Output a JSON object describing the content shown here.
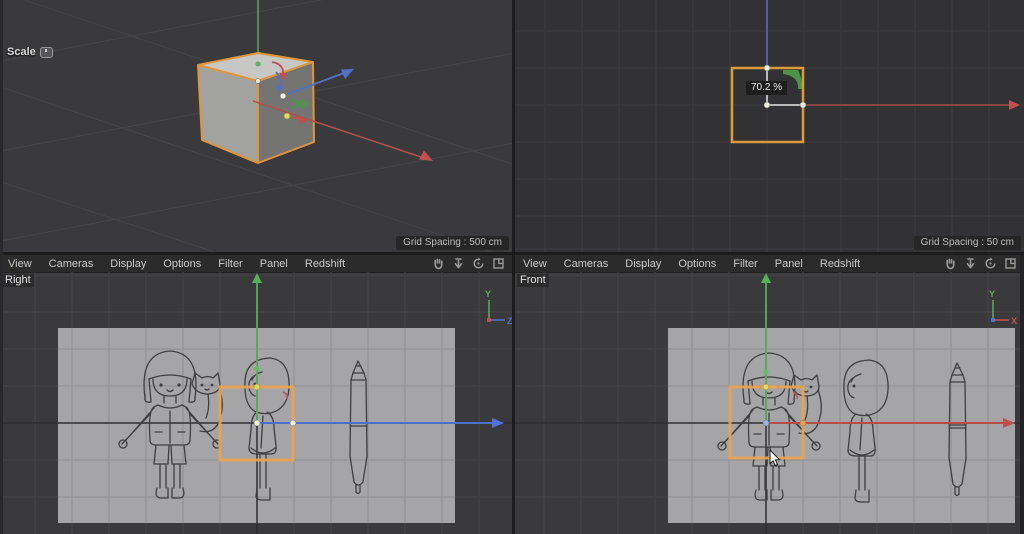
{
  "tool": {
    "label": "Scale"
  },
  "menu": {
    "items": [
      "View",
      "Cameras",
      "Display",
      "Options",
      "Filter",
      "Panel",
      "Redshift"
    ]
  },
  "nav_icons": [
    "pan-hand-icon",
    "dolly-arrow-icon",
    "orbit-icon",
    "toggle-view-icon"
  ],
  "viewports": {
    "perspective": {
      "grid_spacing": "Grid Spacing : 500 cm"
    },
    "top": {
      "grid_spacing": "Grid Spacing : 50 cm",
      "scale_readout": "70.2 %"
    },
    "right": {
      "label": "Right",
      "axis_up": "Y",
      "axis_right": "Z"
    },
    "front": {
      "label": "Front",
      "axis_up": "Y",
      "axis_right": "X"
    }
  },
  "colors": {
    "selection_orange": "#e49a3f",
    "axis_x_red": "#c0504d",
    "axis_y_green": "#58a758",
    "axis_z_blue": "#5272c8",
    "handle_cream": "#f2eedd",
    "handle_yellow": "#e3d85e",
    "viewport_bg": "#3a3a3c",
    "menu_bg": "#2b2b2c",
    "reference_sheet_gray": "#a5a5a7"
  }
}
